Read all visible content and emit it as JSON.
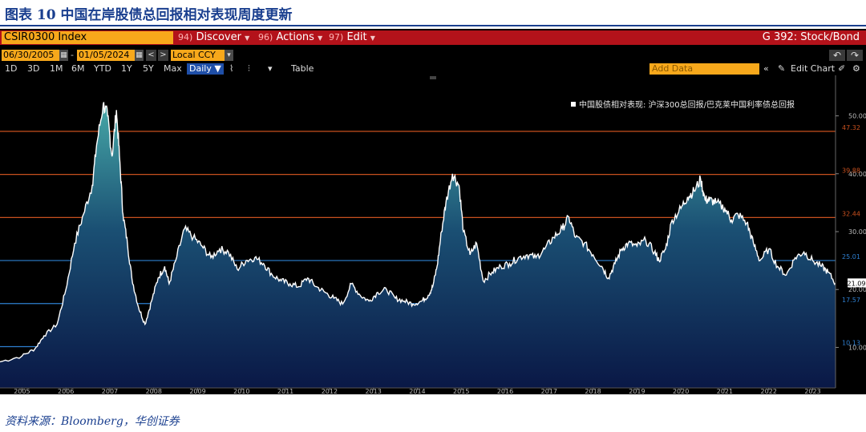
{
  "figure": {
    "title": "图表 10  中国在岸股债总回报相对表现周度更新",
    "source": "资料来源：Bloomberg，华创证券"
  },
  "terminal": {
    "ticker": "CSIR0300 Index",
    "menus": [
      {
        "num": "94)",
        "label": "Discover"
      },
      {
        "num": "96)",
        "label": "Actions"
      },
      {
        "num": "97)",
        "label": "Edit"
      }
    ],
    "function_title": "G 392: Stock/Bond",
    "start_date": "06/30/2005",
    "end_date": "01/05/2024",
    "date_sep": "-",
    "currency": "Local CCY",
    "periods": [
      "1D",
      "3D",
      "1M",
      "6M",
      "YTD",
      "1Y",
      "5Y",
      "Max"
    ],
    "frequency": "Daily ▼",
    "table_label": "Table",
    "add_data_placeholder": "Add Data",
    "edit_chart_label": "Edit Chart",
    "colors": {
      "accent_orange": "#f7a81b",
      "header_red": "#b3121a",
      "selected_blue": "#1f4fa8"
    }
  },
  "chart_data": {
    "type": "area",
    "legend": "中国股债相对表现: 沪深300总回报/巴克莱中国利率债总回报",
    "x_tick_labels": [
      "2005",
      "2006",
      "2007",
      "2008",
      "2009",
      "2010",
      "2011",
      "2012",
      "2013",
      "2014",
      "2015",
      "2016",
      "2017",
      "2018",
      "2019",
      "2020",
      "2021",
      "2022",
      "2023"
    ],
    "y_tick_labels": [
      "10.00",
      "20.00",
      "30.00",
      "40.00",
      "50.00"
    ],
    "ylim": [
      3,
      57
    ],
    "xlim": [
      2005.0,
      2024.02
    ],
    "last_value": "21.09",
    "reference_lines": [
      {
        "label": "47.32",
        "value": 47.32,
        "color": "#c8501e"
      },
      {
        "label": "39.88",
        "value": 39.88,
        "color": "#c8501e"
      },
      {
        "label": "32.44",
        "value": 32.44,
        "color": "#c8501e"
      },
      {
        "label": "25.01",
        "value": 25.01,
        "color": "#2e7fd0"
      },
      {
        "label": "17.57",
        "value": 17.57,
        "color": "#2e7fd0"
      },
      {
        "label": "10.13",
        "value": 10.13,
        "color": "#2e7fd0"
      }
    ],
    "series": [
      {
        "x": [
          2005.0,
          2005.5,
          2005.8,
          2006.0,
          2006.3,
          2006.5,
          2006.7,
          2006.9,
          2007.1,
          2007.2,
          2007.35,
          2007.45,
          2007.55,
          2007.65,
          2007.72,
          2007.8,
          2007.9,
          2008.0,
          2008.15,
          2008.3,
          2008.45,
          2008.6,
          2008.75,
          2008.85,
          2009.0,
          2009.2,
          2009.4,
          2009.6,
          2009.8,
          2010.0,
          2010.2,
          2010.4,
          2010.6,
          2010.8,
          2011.0,
          2011.2,
          2011.4,
          2011.6,
          2011.8,
          2012.0,
          2012.2,
          2012.4,
          2012.6,
          2012.8,
          2013.0,
          2013.2,
          2013.4,
          2013.6,
          2013.8,
          2014.0,
          2014.2,
          2014.4,
          2014.6,
          2014.75,
          2014.85,
          2014.95,
          2015.05,
          2015.15,
          2015.3,
          2015.45,
          2015.55,
          2015.7,
          2015.85,
          2016.0,
          2016.2,
          2016.4,
          2016.6,
          2016.8,
          2017.0,
          2017.2,
          2017.4,
          2017.6,
          2017.8,
          2017.95,
          2018.1,
          2018.3,
          2018.5,
          2018.7,
          2018.85,
          2019.0,
          2019.15,
          2019.3,
          2019.5,
          2019.7,
          2019.9,
          2020.0,
          2020.15,
          2020.3,
          2020.5,
          2020.65,
          2020.8,
          2020.95,
          2021.05,
          2021.15,
          2021.3,
          2021.5,
          2021.65,
          2021.8,
          2022.0,
          2022.15,
          2022.3,
          2022.5,
          2022.7,
          2022.9,
          2023.1,
          2023.3,
          2023.5,
          2023.7,
          2023.85,
          2024.02
        ],
        "y": [
          7.5,
          8.5,
          9.8,
          12.0,
          14.0,
          20.0,
          28.0,
          33.0,
          38.0,
          45.0,
          52.0,
          50.0,
          43.0,
          51.0,
          43.0,
          33.0,
          28.0,
          22.0,
          17.0,
          14.0,
          18.0,
          22.0,
          24.0,
          21.0,
          25.0,
          30.5,
          29.0,
          27.5,
          25.5,
          27.0,
          26.5,
          23.5,
          25.0,
          25.5,
          24.5,
          22.5,
          21.5,
          21.0,
          20.5,
          22.0,
          20.5,
          19.5,
          18.5,
          17.5,
          21.0,
          19.0,
          18.0,
          19.5,
          20.0,
          18.5,
          18.0,
          17.5,
          18.0,
          19.0,
          20.5,
          24.0,
          30.0,
          35.0,
          40.0,
          38.0,
          30.0,
          26.0,
          28.0,
          21.5,
          23.0,
          24.0,
          24.5,
          25.5,
          26.0,
          25.5,
          27.0,
          29.0,
          30.5,
          32.5,
          29.0,
          28.0,
          26.0,
          24.0,
          22.0,
          24.5,
          27.0,
          28.0,
          27.5,
          28.5,
          26.5,
          25.0,
          27.0,
          32.0,
          34.0,
          36.0,
          37.0,
          39.0,
          35.5,
          35.5,
          35.0,
          34.0,
          32.0,
          33.0,
          31.5,
          28.0,
          25.0,
          27.0,
          24.0,
          22.5,
          25.5,
          26.5,
          25.0,
          24.0,
          23.0,
          21.09
        ]
      }
    ]
  }
}
